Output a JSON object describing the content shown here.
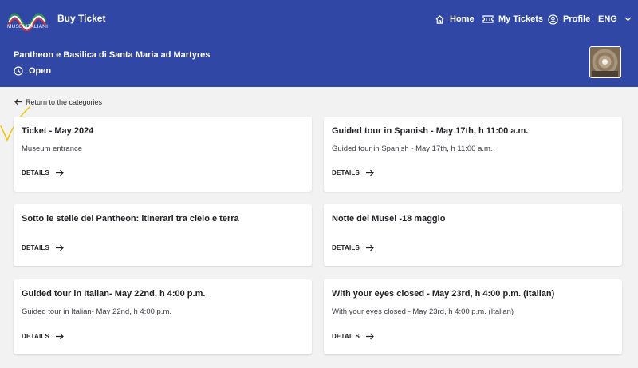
{
  "header": {
    "logo_text": "MUSEI ITALIANI",
    "app_title": "Buy Ticket",
    "nav": {
      "home": "Home",
      "tickets": "My Tickets",
      "profile": "Profile",
      "language": "ENG"
    }
  },
  "site": {
    "name": "Pantheon e Basilica di Santa Maria ad Martyres",
    "status": "Open"
  },
  "back_link": "Return to the categories",
  "cards": [
    {
      "title": "Ticket - May 2024",
      "description": "Museum entrance",
      "details": "DETAILS"
    },
    {
      "title": "Guided tour in Spanish - May 17th, h 11:00 a.m.",
      "description": "Guided tour in Spanish - May 17th, h 11:00 a.m.",
      "details": "DETAILS"
    },
    {
      "title": "Sotto le stelle del Pantheon: itinerari tra cielo e terra",
      "description": "",
      "details": "DETAILS"
    },
    {
      "title": "Notte dei Musei -18 maggio",
      "description": "",
      "details": "DETAILS"
    },
    {
      "title": "Guided tour in Italian- May 22nd, h 4:00 p.m.",
      "description": "Guided tour in Italian- May 22nd, h 4:00 p.m.",
      "details": "DETAILS"
    },
    {
      "title": "With your eyes closed - May 23rd, h 4:00 p.m. (Italian)",
      "description": "With your eyes closed - May 23rd, h 4:00 p.m. (Italian)",
      "details": "DETAILS"
    }
  ],
  "icons": {
    "logo": "musei-italiani-logo",
    "home": "home-icon",
    "tickets": "ticket-icon",
    "profile": "user-circle-icon",
    "language": "chevron-down-icon",
    "status": "clock-icon",
    "back": "arrow-left-icon",
    "details": "arrow-right-icon"
  },
  "colors": {
    "header_bg": "#3047a5",
    "page_bg": "#f2f2f3",
    "card_bg": "#ffffff",
    "annotation": "#f2c400"
  }
}
